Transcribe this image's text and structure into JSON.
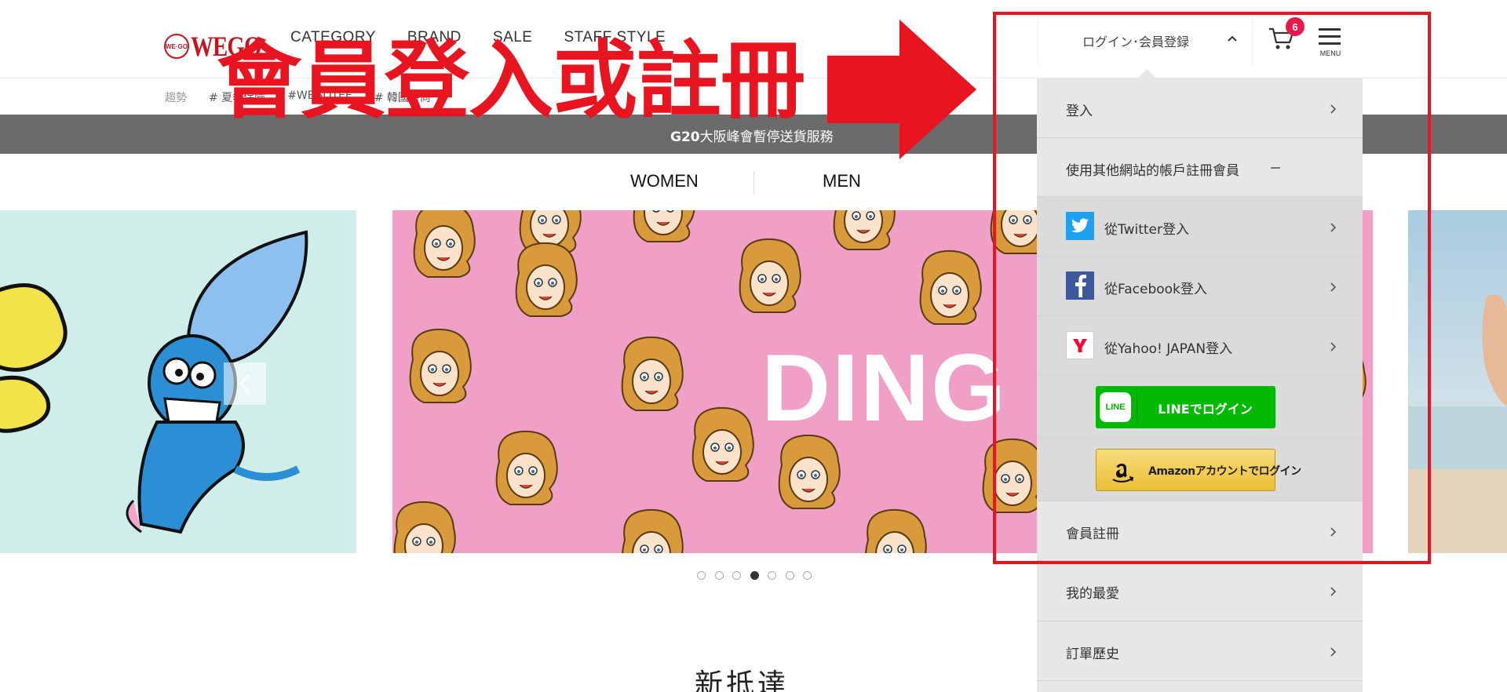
{
  "header": {
    "logo_text": "WEGO",
    "logo_mark": "WE·GO",
    "nav": [
      "CATEGORY",
      "BRAND",
      "SALE",
      "STAFF STYLE"
    ],
    "login_toggle": "ログイン･会員登録",
    "cart_count": "6",
    "menu_label": "MENU"
  },
  "tags": {
    "label": "趨勢",
    "items": [
      "# 夏季保險",
      "#WEGOTEE",
      "# 韓國時尚"
    ]
  },
  "notice": {
    "bold": "G20",
    "text": "大阪峰會暫停送貨服務"
  },
  "gender_tabs": [
    "WOMEN",
    "MEN"
  ],
  "carousel": {
    "slide_text": "DING",
    "dot_count": 7,
    "active_dot": 4
  },
  "section_title": "新抵達",
  "dropdown": {
    "login": "登入",
    "other_accounts": "使用其他網站的帳戶註冊會員",
    "twitter": "從Twitter登入",
    "facebook": "從Facebook登入",
    "yahoo": "從Yahoo! JAPAN登入",
    "line_logo": "LINE",
    "line_button": "LINEでログイン",
    "amazon_button": "Amazonアカウントでログイン",
    "register": "會員註冊",
    "favorites": "我的最愛",
    "order_history": "訂單歷史"
  },
  "annotation": {
    "text": "會員登入或註冊",
    "color": "#e8141f"
  },
  "colors": {
    "brand_red": "#c5141c",
    "badge": "#e8184a",
    "notice_bg": "#6b6b6b",
    "dropdown_bg": "#e6e7e6",
    "line_green": "#00b900",
    "twitter_blue": "#1da1f2",
    "facebook_blue": "#3b5998",
    "yahoo_red": "#ff0033"
  }
}
